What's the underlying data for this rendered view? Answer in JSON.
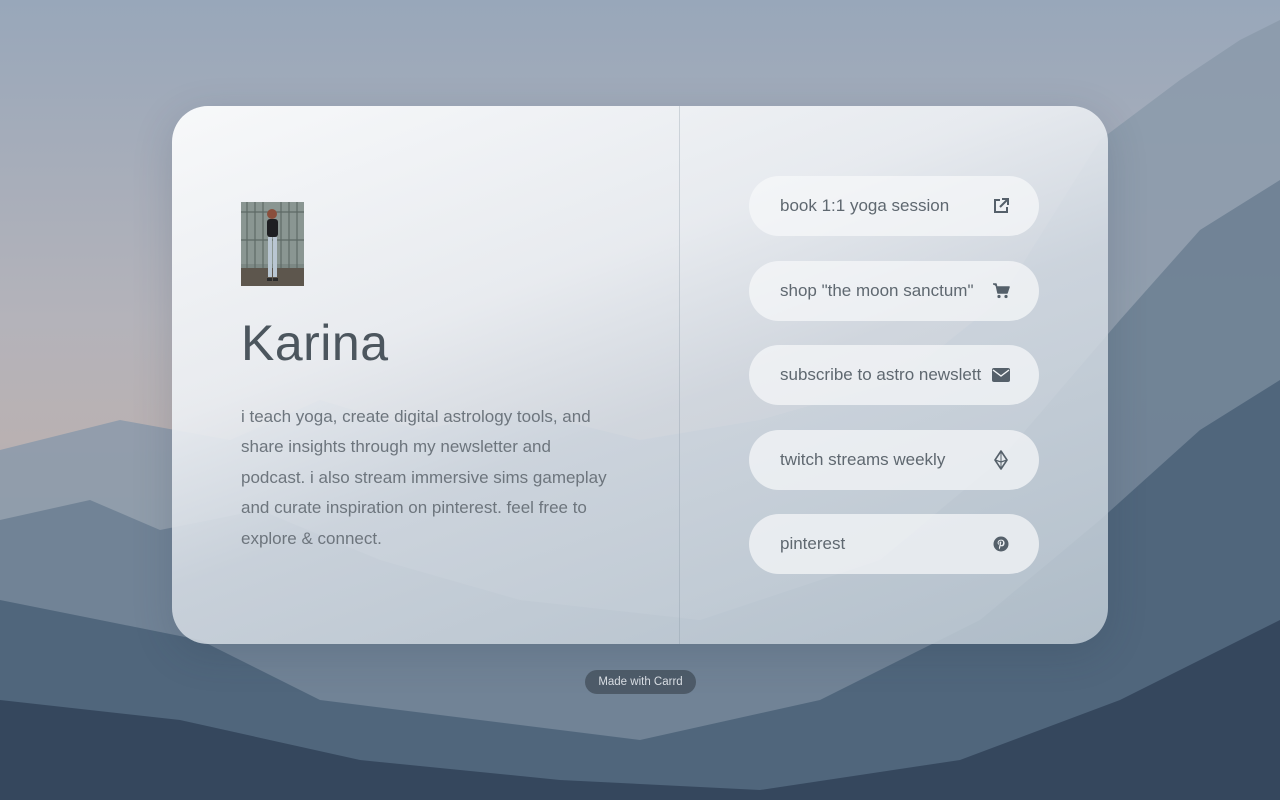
{
  "profile": {
    "name": "Karina",
    "bio": "i teach yoga, create digital astrology tools, and share insights through my newsletter and podcast. i also stream immersive sims gameplay and curate inspiration on pinterest. feel free to explore & connect."
  },
  "links": [
    {
      "label": "book 1:1 yoga session",
      "icon": "external-link-icon"
    },
    {
      "label": "shop \"the moon sanctum\"",
      "icon": "shopping-cart-icon"
    },
    {
      "label": "subscribe to astro newsletter",
      "icon": "envelope-icon"
    },
    {
      "label": "twitch streams weekly",
      "icon": "diamond-icon"
    },
    {
      "label": "pinterest",
      "icon": "pinterest-icon"
    }
  ],
  "footer": {
    "badge_label": "Made with Carrd"
  },
  "colors": {
    "icon": "#55606a",
    "text": "#5f6870",
    "heading": "#4c565e"
  }
}
